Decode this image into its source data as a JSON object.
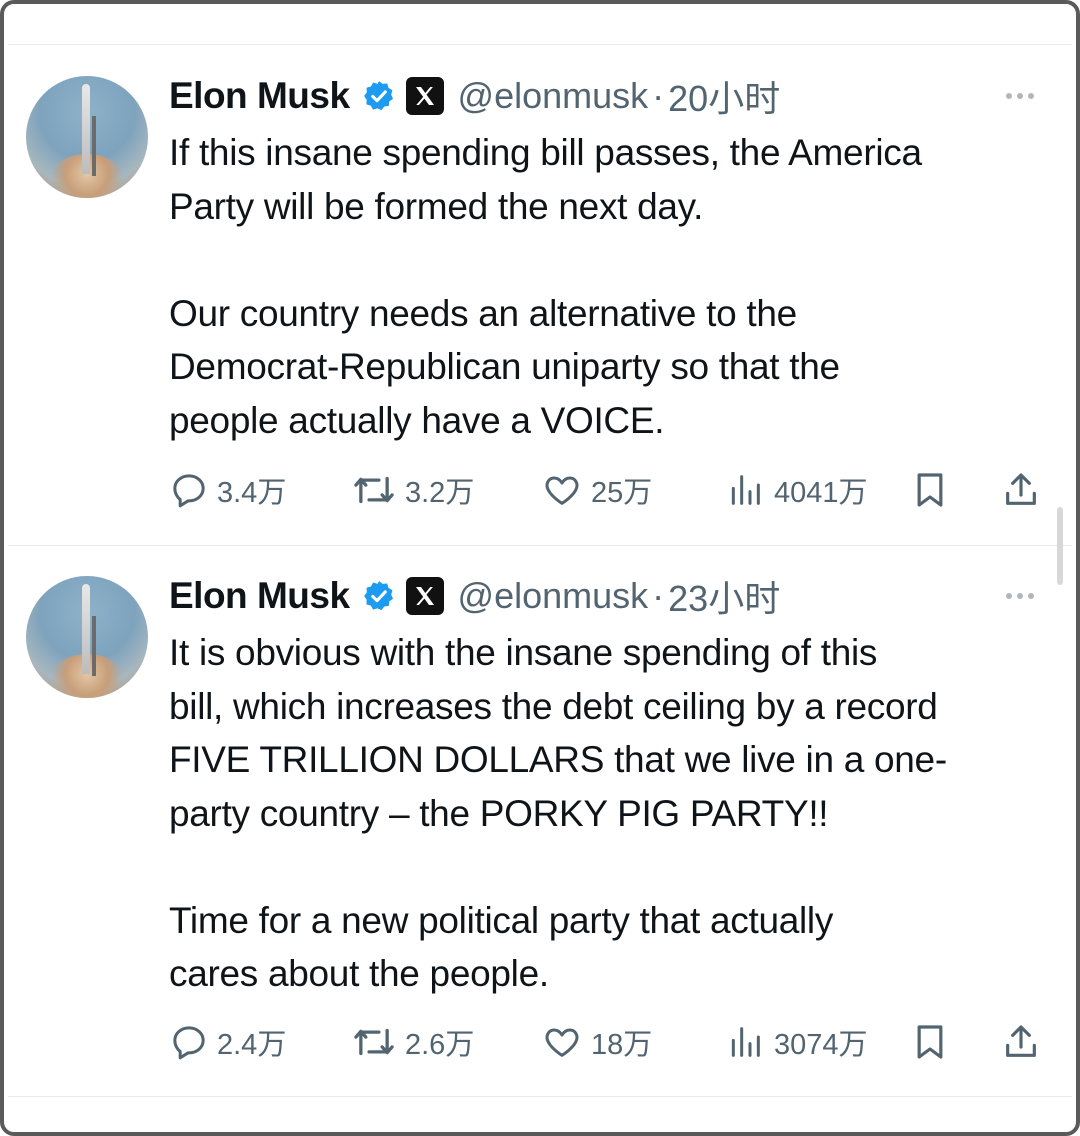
{
  "tweets": [
    {
      "name": "Elon Musk",
      "handle": "@elonmusk",
      "separator": "·",
      "time": "20小时",
      "text": "If this insane spending bill passes, the America\nParty will be formed the next day.\n\nOur country needs an alternative to the\nDemocrat-Republican uniparty so that the\npeople actually have a VOICE.",
      "replies": "3.4万",
      "reposts": "3.2万",
      "likes": "25万",
      "views": "4041万"
    },
    {
      "name": "Elon Musk",
      "handle": "@elonmusk",
      "separator": "·",
      "time": "23小时",
      "text": "It is obvious with the insane spending of this\nbill, which increases the debt ceiling by a record\nFIVE TRILLION DOLLARS that we live in a one-\nparty country – the PORKY PIG PARTY!!\n\nTime for a new political party that actually\ncares about the people.",
      "replies": "2.4万",
      "reposts": "2.6万",
      "likes": "18万",
      "views": "3074万"
    }
  ],
  "icons": {
    "avatar": "rocket-launch-avatar",
    "verified": "verified-badge-icon",
    "affiliate": "x-logo-icon",
    "more": "more-options-icon",
    "reply": "reply-icon",
    "repost": "repost-icon",
    "like": "heart-icon",
    "views": "views-icon",
    "bookmark": "bookmark-icon",
    "share": "share-icon"
  },
  "colors": {
    "text": "#0f1419",
    "secondary": "#536471",
    "verified": "#1d9bf0",
    "divider": "#e7e9ea"
  }
}
